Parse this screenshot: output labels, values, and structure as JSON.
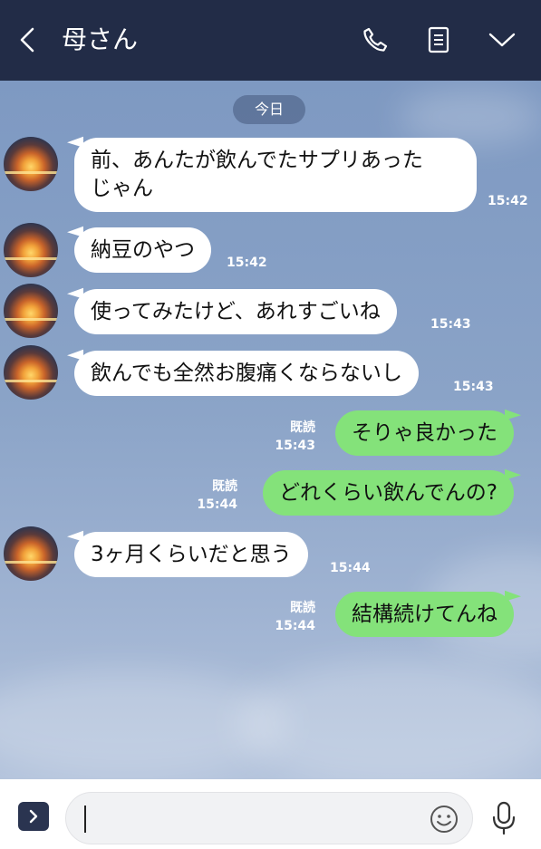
{
  "header": {
    "title": "母さん",
    "icons": [
      "back-icon",
      "phone-icon",
      "notes-icon",
      "chevron-down-icon"
    ]
  },
  "chat": {
    "date_label": "今日",
    "messages": [
      {
        "side": "in",
        "text_line1": "前、あんたが飲んでたサプリあった",
        "text_line2": "じゃん",
        "time": "15:42"
      },
      {
        "side": "in",
        "text": "納豆のやつ",
        "time": "15:42"
      },
      {
        "side": "in",
        "text": "使ってみたけど、あれすごいね",
        "time": "15:43"
      },
      {
        "side": "in",
        "text": "飲んでも全然お腹痛くならないし",
        "time": "15:43"
      },
      {
        "side": "out",
        "text": "そりゃ良かった",
        "read": "既読",
        "time": "15:43"
      },
      {
        "side": "out",
        "text": "どれくらい飲んでんの?",
        "read": "既読",
        "time": "15:44"
      },
      {
        "side": "in",
        "text": "3ヶ月くらいだと思う",
        "time": "15:44"
      },
      {
        "side": "out",
        "text": "結構続けてんね",
        "read": "既読",
        "time": "15:44"
      }
    ]
  },
  "footer": {
    "input_value": "",
    "icons": [
      "expand-icon",
      "emoji-icon",
      "microphone-icon"
    ]
  },
  "colors": {
    "header_bg": "#222c47",
    "incoming_bubble": "#ffffff",
    "outgoing_bubble": "#84e27a",
    "chat_bg": "#8aa3c7"
  }
}
